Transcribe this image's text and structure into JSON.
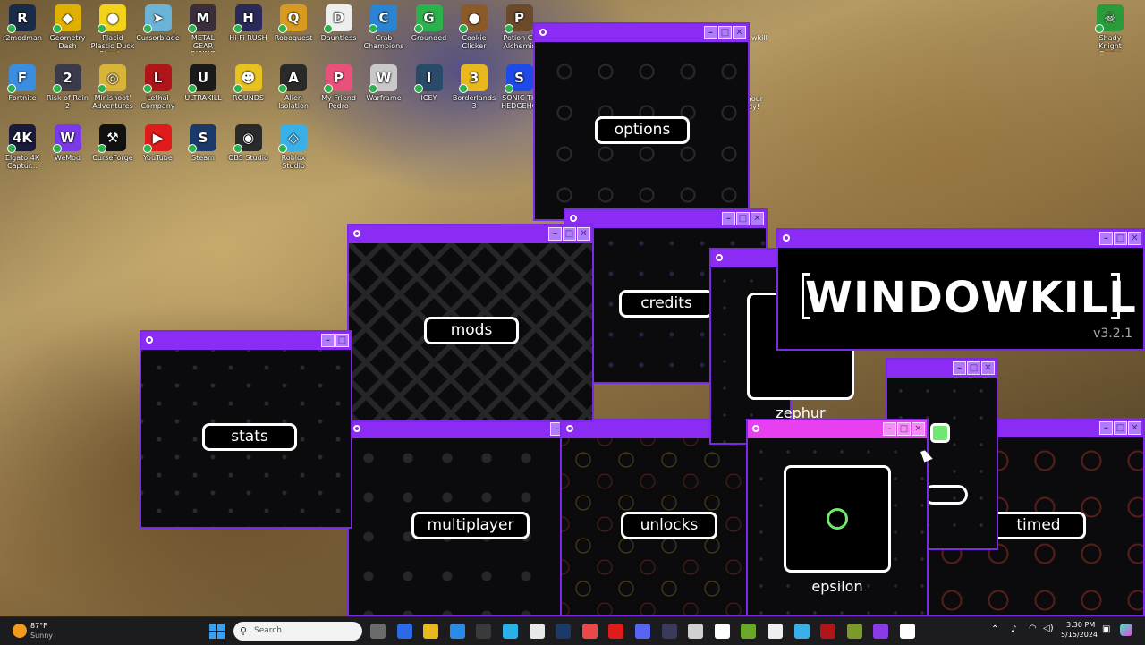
{
  "desktop": {
    "icons": [
      {
        "label": "r2modman",
        "glyph": "R",
        "color": "#1a2b4a"
      },
      {
        "label": "Geometry Dash",
        "glyph": "◆",
        "color": "#e0b000"
      },
      {
        "label": "Placid Plastic Duck Simul...",
        "glyph": "●",
        "color": "#f2d21b"
      },
      {
        "label": "Cursorblade",
        "glyph": "➤",
        "color": "#6cb3d8"
      },
      {
        "label": "METAL GEAR RISING REV...",
        "glyph": "M",
        "color": "#3a2e3a"
      },
      {
        "label": "Hi-Fi RUSH",
        "glyph": "H",
        "color": "#2a2a5a"
      },
      {
        "label": "Roboquest",
        "glyph": "Q",
        "color": "#d89a1e"
      },
      {
        "label": "Dauntless",
        "glyph": "D",
        "color": "#eeeeee"
      },
      {
        "label": "Crab Champions",
        "glyph": "C",
        "color": "#2a84d2"
      },
      {
        "label": "Grounded",
        "glyph": "G",
        "color": "#2bb24c"
      },
      {
        "label": "Cookie Clicker",
        "glyph": "●",
        "color": "#8b5a2b"
      },
      {
        "label": "Potion Cr Alchemis",
        "glyph": "P",
        "color": "#6b4a2a"
      },
      {
        "label": "Fortnite",
        "glyph": "F",
        "color": "#3b8de0"
      },
      {
        "label": "Risk of Rain 2",
        "glyph": "2",
        "color": "#3a3a4a"
      },
      {
        "label": "Minishoot' Adventures",
        "glyph": "◎",
        "color": "#d8b43a"
      },
      {
        "label": "Lethal Company",
        "glyph": "L",
        "color": "#b0151a"
      },
      {
        "label": "ULTRAKILL",
        "glyph": "U",
        "color": "#1a1a1a"
      },
      {
        "label": "ROUNDS",
        "glyph": "☻",
        "color": "#e8c21e"
      },
      {
        "label": "Alien Isolation",
        "glyph": "A",
        "color": "#2a2a2a"
      },
      {
        "label": "My Friend Pedro",
        "glyph": "P",
        "color": "#e8527a"
      },
      {
        "label": "Warframe",
        "glyph": "W",
        "color": "#c9c9c9"
      },
      {
        "label": "ICEY",
        "glyph": "I",
        "color": "#2a4a6a"
      },
      {
        "label": "Borderlands 3",
        "glyph": "3",
        "color": "#e8b81e"
      },
      {
        "label": "SONIC TH HEDGEHO",
        "glyph": "S",
        "color": "#1e4ae8"
      },
      {
        "label": "Elgato 4K Captur...",
        "glyph": "4K",
        "color": "#1a1a3a"
      },
      {
        "label": "WeMod",
        "glyph": "W",
        "color": "#7a3ae8"
      },
      {
        "label": "CurseForge",
        "glyph": "⚒",
        "color": "#111111"
      },
      {
        "label": "YouTube",
        "glyph": "▶",
        "color": "#e01b1b"
      },
      {
        "label": "Steam",
        "glyph": "S",
        "color": "#1b3a6a"
      },
      {
        "label": "OBS Studio",
        "glyph": "◉",
        "color": "#2a2a2a"
      },
      {
        "label": "Roblox Studio",
        "glyph": "◇",
        "color": "#3ab0e8"
      }
    ],
    "right_icons": [
      {
        "label": "Shady Knight Demo",
        "glyph": "☠",
        "color": "#2a9a3a"
      }
    ],
    "partial_labels": [
      "wkill",
      "Your dy!"
    ]
  },
  "windows": {
    "options": {
      "label": "options"
    },
    "credits": {
      "label": "credits"
    },
    "mods": {
      "label": "mods"
    },
    "stats": {
      "label": "stats"
    },
    "multiplayer": {
      "label": "multiplayer"
    },
    "unlocks": {
      "label": "unlocks"
    },
    "zephyr": {
      "label": "zephur"
    },
    "epsilon": {
      "label": "epsilon"
    },
    "timed": {
      "label": "timed"
    },
    "title": {
      "name": "WINDOWKILL",
      "version": "v3.2.1"
    }
  },
  "colors": {
    "titlebar": "#8b2cf5",
    "titlebar_active": "#e83ff0",
    "accent_green": "#6ee86e"
  },
  "taskbar": {
    "weather": {
      "temp": "87°F",
      "condition": "Sunny"
    },
    "search_placeholder": "Search",
    "time": "3:30 PM",
    "date": "5/15/2024"
  }
}
